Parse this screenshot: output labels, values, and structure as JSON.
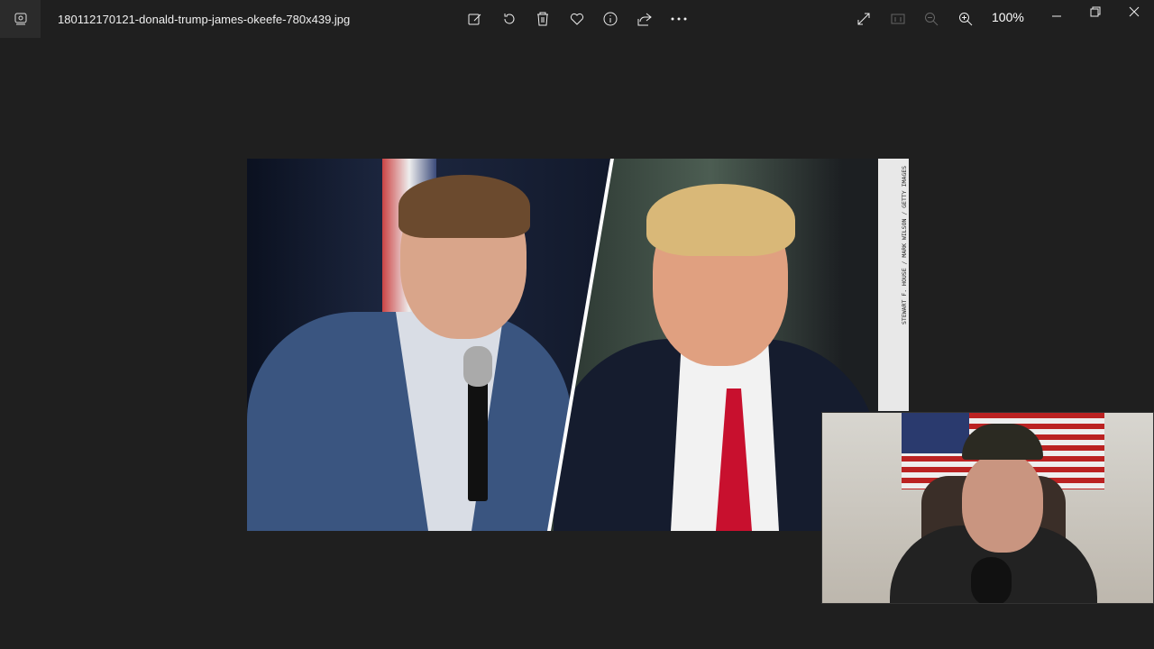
{
  "window": {
    "filename": "180112170121-donald-trump-james-okeefe-780x439.jpg",
    "zoom_level": "100%"
  },
  "toolbar": {
    "icons": [
      "edit-icon",
      "rotate-icon",
      "delete-icon",
      "favorite-icon",
      "info-icon",
      "share-icon",
      "more-icon"
    ]
  },
  "image": {
    "credit": "STEWART F. HOUSE / MARK WILSON / GETTY IMAGES"
  },
  "colors": {
    "background": "#1f1f1f",
    "tie": "#c8102e"
  }
}
